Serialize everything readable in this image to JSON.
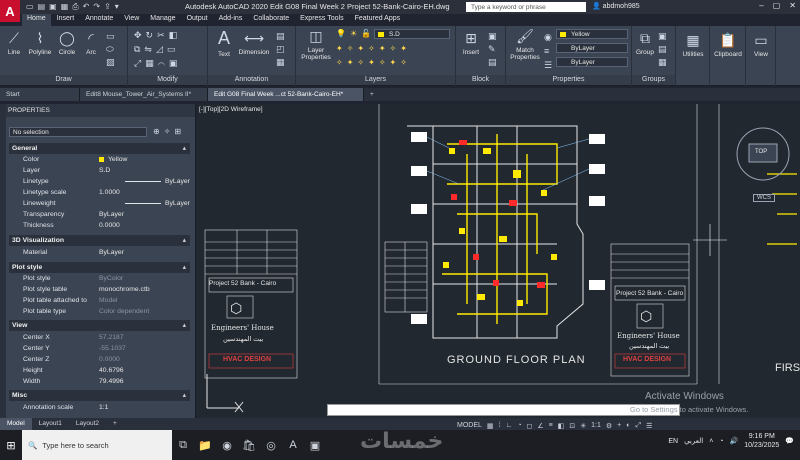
{
  "app": {
    "logo_letter": "A",
    "title": "Autodesk AutoCAD 2020    Edit G08 Final Week 2 Project 52-Bank-Cairo-EH.dwg",
    "search_placeholder": "Type a keyword or phrase",
    "user": "abdmoh985"
  },
  "ribbon_tabs": [
    "Home",
    "Insert",
    "Annotate",
    "View",
    "Manage",
    "Output",
    "Add-ins",
    "Collaborate",
    "Express Tools",
    "Featured Apps"
  ],
  "ribbon": {
    "draw": {
      "title": "Draw",
      "line": "Line",
      "polyline": "Polyline",
      "circle": "Circle",
      "arc": "Arc"
    },
    "modify": {
      "title": "Modify"
    },
    "annotation": {
      "title": "Annotation",
      "text": "Text",
      "dimension": "Dimension"
    },
    "layers": {
      "title": "Layers",
      "layer_properties": "Layer Properties",
      "current_layer": "S.D"
    },
    "block": {
      "title": "Block",
      "insert": "Insert"
    },
    "properties": {
      "title": "Properties",
      "match": "Match Properties",
      "color": "Yellow",
      "linetype": "ByLayer",
      "lineweight": "ByLayer"
    },
    "groups": {
      "title": "Groups",
      "group": "Group"
    },
    "utilities": "Utilities",
    "clipboard": "Clipboard",
    "view": "View"
  },
  "doc_tabs": [
    "Start",
    "Edit8 Mouse_Tower_Air_Systems II*",
    "Edit G08 Final Week ...ct 52-Bank-Cairo-EH*"
  ],
  "viewport_label": "[-][Top][2D Wireframe]",
  "properties_panel": {
    "title": "PROPERTIES",
    "selection": "No selection",
    "sections": {
      "general": "General",
      "viz": "3D Visualization",
      "plot": "Plot style",
      "view": "View",
      "misc": "Misc"
    },
    "general": [
      {
        "k": "Color",
        "v": "Yellow"
      },
      {
        "k": "Layer",
        "v": "S.D"
      },
      {
        "k": "Linetype",
        "v": "ByLayer"
      },
      {
        "k": "Linetype scale",
        "v": "1.0000"
      },
      {
        "k": "Lineweight",
        "v": "ByLayer"
      },
      {
        "k": "Transparency",
        "v": "ByLayer"
      },
      {
        "k": "Thickness",
        "v": "0.0000"
      }
    ],
    "viz": [
      {
        "k": "Material",
        "v": "ByLayer"
      }
    ],
    "plot": [
      {
        "k": "Plot style",
        "v": "ByColor"
      },
      {
        "k": "Plot style table",
        "v": "monochrome.ctb"
      },
      {
        "k": "Plot table attached to",
        "v": "Model"
      },
      {
        "k": "Plot table type",
        "v": "Color dependent"
      }
    ],
    "view": [
      {
        "k": "Center X",
        "v": "57.2187"
      },
      {
        "k": "Center Y",
        "v": "-55.1037"
      },
      {
        "k": "Center Z",
        "v": "0.0000"
      },
      {
        "k": "Height",
        "v": "40.6796"
      },
      {
        "k": "Width",
        "v": "79.4996"
      }
    ],
    "misc": [
      {
        "k": "Annotation scale",
        "v": "1:1"
      }
    ]
  },
  "drawing": {
    "plan_title": "GROUND FLOOR PLAN",
    "plan_title_right": "FIRS",
    "project_label": "Project 52 Bank - Cairo",
    "company": "Engineers' House",
    "company_ar": "بيت المهندسين",
    "discipline": "HVAC DESIGN",
    "viewcube": "TOP",
    "wcs": "WCS"
  },
  "activation": {
    "line1": "Activate Windows",
    "line2": "Go to Settings to activate Windows."
  },
  "layout_tabs": [
    "Model",
    "Layout1",
    "Layout2"
  ],
  "status": {
    "model": "MODEL",
    "scale": "1:1",
    "lang": "EN"
  },
  "taskbar": {
    "search": "Type here to search",
    "time": "9:16 PM",
    "date": "10/23/2025",
    "lang_ar": "العربي"
  },
  "watermark": "خمسات"
}
